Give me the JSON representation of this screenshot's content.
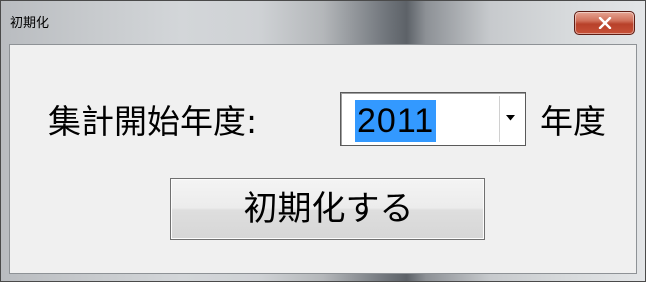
{
  "window": {
    "title": "初期化",
    "close_icon": "close-x-icon"
  },
  "dialog": {
    "start_year_label": "集計開始年度:",
    "year_select": {
      "value": "2011",
      "selected_text_highlight": "#3399ff",
      "arrow_icon": "chevron-down-icon"
    },
    "year_suffix": "年度",
    "initialize_button_label": "初期化する"
  },
  "colors": {
    "close_button": "#c75138",
    "client_background": "#f0f0f0"
  }
}
